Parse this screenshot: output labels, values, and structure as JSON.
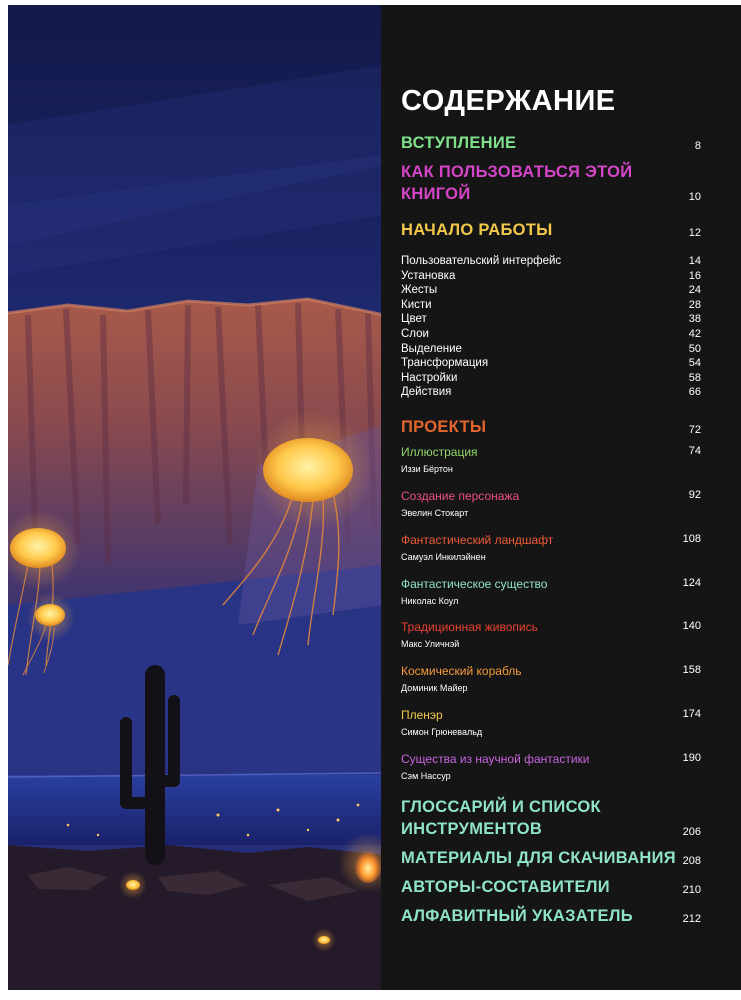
{
  "contents": {
    "title": "СОДЕРЖАНИЕ",
    "intro": {
      "label": "ВСТУПЛЕНИЕ",
      "page": "8",
      "color": "#7ee08a"
    },
    "howto": {
      "label_line1": "КАК ПОЛЬЗОВАТЬСЯ ЭТОЙ",
      "label_line2": "КНИГОЙ",
      "page": "10",
      "color": "#d545c8"
    },
    "start": {
      "label": "НАЧАЛО РАБОТЫ",
      "page": "12",
      "color": "#f2c84a"
    },
    "start_items": [
      {
        "label": "Пользовательский интерфейс",
        "page": "14"
      },
      {
        "label": "Установка",
        "page": "16"
      },
      {
        "label": "Жесты",
        "page": "24"
      },
      {
        "label": "Кисти",
        "page": "28"
      },
      {
        "label": "Цвет",
        "page": "38"
      },
      {
        "label": "Слои",
        "page": "42"
      },
      {
        "label": "Выделение",
        "page": "50"
      },
      {
        "label": "Трансформация",
        "page": "54"
      },
      {
        "label": "Настройки",
        "page": "58"
      },
      {
        "label": "Действия",
        "page": "66"
      }
    ],
    "projects": {
      "label": "ПРОЕКТЫ",
      "page": "72",
      "color": "#e2662d"
    },
    "project_items": [
      {
        "title": "Иллюстрация",
        "author": "Иззи Бёртон",
        "page": "74",
        "color": "#8fd46a"
      },
      {
        "title": "Создание персонажа",
        "author": "Эвелин Стокарт",
        "page": "92",
        "color": "#ee4f8a"
      },
      {
        "title": "Фантастический ландшафт",
        "author": "Самуэл Инкилэйнен",
        "page": "108",
        "color": "#ef5a36"
      },
      {
        "title": "Фантастическое существо",
        "author": "Николас Коул",
        "page": "124",
        "color": "#8fe3c6"
      },
      {
        "title": "Традиционная живопись",
        "author": "Макс Уличнэй",
        "page": "140",
        "color": "#e8412f"
      },
      {
        "title": "Космический корабль",
        "author": "Доминик Майер",
        "page": "158",
        "color": "#f59a3c"
      },
      {
        "title": "Пленэр",
        "author": "Симон Грюневальд",
        "page": "174",
        "color": "#f2c84a"
      },
      {
        "title": "Существа из научной фантастики",
        "author": "Сэм Нассур",
        "page": "190",
        "color": "#c864e0"
      }
    ],
    "glossary": {
      "label_line1": "ГЛОССАРИЙ И СПИСОК",
      "label_line2": "ИНСТРУМЕНТОВ",
      "page": "206",
      "color": "#8fe3c6"
    },
    "downloads": {
      "label": "МАТЕРИАЛЫ ДЛЯ СКАЧИВАНИЯ",
      "page": "208",
      "color": "#8fe3c6"
    },
    "authors": {
      "label": "АВТОРЫ-СОСТАВИТЕЛИ",
      "page": "210",
      "color": "#8fe3c6"
    },
    "index": {
      "label": "АЛФАВИТНЫЙ УКАЗАТЕЛЬ",
      "page": "212",
      "color": "#8fe3c6"
    }
  }
}
